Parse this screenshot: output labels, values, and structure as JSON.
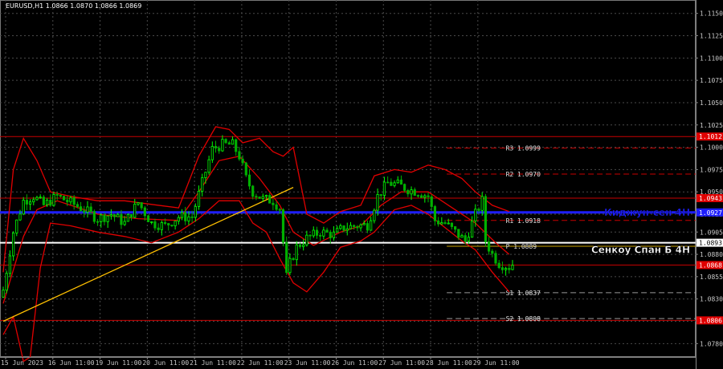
{
  "header": {
    "symbol_info": "EURUSD,H1  1.0866 1.0870 1.0866 1.0869"
  },
  "colors": {
    "background": "#000000",
    "grid": "#4a4a4a",
    "bull_candle": "#00ff00",
    "bear_candle": "#00b000",
    "band": "#e00000",
    "trend": "#ffc000",
    "kijun": "#1e1eff",
    "senkou": "#ffffff",
    "resistance": "#c80000",
    "pivot": "#c8a000",
    "support_dash": "#999999",
    "badge_red": "#e00000",
    "badge_blue": "#1e1eff",
    "badge_white": "#ffffff"
  },
  "chart_data": {
    "type": "candlestick",
    "ylim": [
      1.0765,
      1.1165
    ],
    "yticks": [
      "1.1150",
      "1.1125",
      "1.1100",
      "1.1075",
      "1.1050",
      "1.1025",
      "1.1000",
      "1.0975",
      "1.0950",
      "1.0925",
      "1.0905",
      "1.0880",
      "1.0855",
      "1.0830",
      "1.0805",
      "1.0780"
    ],
    "ytick_values": [
      1.115,
      1.1125,
      1.11,
      1.1075,
      1.105,
      1.1025,
      1.1,
      1.0975,
      1.095,
      1.0925,
      1.0905,
      1.088,
      1.0855,
      1.083,
      1.0805,
      1.078
    ],
    "x_labels": [
      "15 Jun 2023",
      "16 Jun 11:00",
      "19 Jun 11:00",
      "20 Jun 11:00",
      "21 Jun 11:00",
      "22 Jun 11:00",
      "23 Jun 11:00",
      "26 Jun 11:00",
      "27 Jun 11:00",
      "28 Jun 11:00",
      "29 Jun 11:00"
    ],
    "x_label_bars": [
      0,
      14,
      28,
      42,
      56,
      70,
      84,
      98,
      112,
      126,
      140
    ],
    "bar_count": 152,
    "close_path": [
      [
        0,
        1.084
      ],
      [
        3,
        1.0905
      ],
      [
        6,
        1.094
      ],
      [
        9,
        1.0945
      ],
      [
        12,
        1.0935
      ],
      [
        16,
        1.0945
      ],
      [
        20,
        1.0938
      ],
      [
        24,
        1.093
      ],
      [
        28,
        1.092
      ],
      [
        32,
        1.0925
      ],
      [
        36,
        1.0915
      ],
      [
        40,
        1.0938
      ],
      [
        44,
        1.0915
      ],
      [
        48,
        1.0912
      ],
      [
        52,
        1.0922
      ],
      [
        56,
        1.0922
      ],
      [
        59,
        1.096
      ],
      [
        62,
        1.0998
      ],
      [
        65,
        1.1003
      ],
      [
        68,
        1.1003
      ],
      [
        70,
        1.099
      ],
      [
        72,
        1.0965
      ],
      [
        74,
        1.095
      ],
      [
        77,
        1.0942
      ],
      [
        80,
        1.094
      ],
      [
        82,
        1.0932
      ],
      [
        84,
        1.0855
      ],
      [
        85,
        1.087
      ],
      [
        87,
        1.0888
      ],
      [
        90,
        1.0898
      ],
      [
        94,
        1.0905
      ],
      [
        98,
        1.0902
      ],
      [
        101,
        1.091
      ],
      [
        105,
        1.0912
      ],
      [
        108,
        1.0913
      ],
      [
        111,
        1.0945
      ],
      [
        114,
        1.096
      ],
      [
        117,
        1.0958
      ],
      [
        120,
        1.0953
      ],
      [
        123,
        1.095
      ],
      [
        126,
        1.0945
      ],
      [
        128,
        1.0918
      ],
      [
        131,
        1.0915
      ],
      [
        134,
        1.0905
      ],
      [
        137,
        1.0895
      ],
      [
        140,
        1.0925
      ],
      [
        142,
        1.094
      ],
      [
        143,
        1.0895
      ],
      [
        145,
        1.088
      ],
      [
        147,
        1.087
      ],
      [
        150,
        1.0866
      ],
      [
        151,
        1.0869
      ]
    ],
    "band_upper": [
      [
        0,
        1.086
      ],
      [
        3,
        1.0975
      ],
      [
        6,
        1.101
      ],
      [
        10,
        1.0985
      ],
      [
        14,
        1.095
      ],
      [
        20,
        1.0945
      ],
      [
        28,
        1.094
      ],
      [
        36,
        1.094
      ],
      [
        44,
        1.0936
      ],
      [
        52,
        1.0932
      ],
      [
        58,
        1.099
      ],
      [
        63,
        1.1023
      ],
      [
        67,
        1.102
      ],
      [
        71,
        1.1005
      ],
      [
        76,
        1.101
      ],
      [
        80,
        1.0995
      ],
      [
        83,
        1.099
      ],
      [
        86,
        1.1
      ],
      [
        90,
        1.0925
      ],
      [
        95,
        1.0915
      ],
      [
        100,
        1.0928
      ],
      [
        106,
        1.0935
      ],
      [
        110,
        1.0968
      ],
      [
        116,
        1.0975
      ],
      [
        121,
        1.0972
      ],
      [
        126,
        1.098
      ],
      [
        131,
        1.0975
      ],
      [
        136,
        1.0965
      ],
      [
        140,
        1.095
      ],
      [
        145,
        1.0935
      ],
      [
        150,
        1.0928
      ]
    ],
    "band_lower": [
      [
        0,
        1.079
      ],
      [
        3,
        1.081
      ],
      [
        6,
        1.076
      ],
      [
        8,
        1.0765
      ],
      [
        11,
        1.0865
      ],
      [
        14,
        1.0915
      ],
      [
        20,
        1.0912
      ],
      [
        28,
        1.0905
      ],
      [
        36,
        1.09
      ],
      [
        44,
        1.0893
      ],
      [
        52,
        1.0905
      ],
      [
        58,
        1.092
      ],
      [
        64,
        1.094
      ],
      [
        70,
        1.094
      ],
      [
        74,
        1.0915
      ],
      [
        78,
        1.0905
      ],
      [
        82,
        1.0875
      ],
      [
        86,
        1.0848
      ],
      [
        90,
        1.0838
      ],
      [
        95,
        1.086
      ],
      [
        100,
        1.0888
      ],
      [
        106,
        1.0895
      ],
      [
        110,
        1.0905
      ],
      [
        116,
        1.093
      ],
      [
        121,
        1.0935
      ],
      [
        126,
        1.0925
      ],
      [
        131,
        1.091
      ],
      [
        136,
        1.0895
      ],
      [
        140,
        1.0885
      ],
      [
        145,
        1.086
      ],
      [
        150,
        1.0838
      ]
    ],
    "band_mid": [
      [
        0,
        1.0825
      ],
      [
        6,
        1.09
      ],
      [
        10,
        1.093
      ],
      [
        16,
        1.094
      ],
      [
        28,
        1.0925
      ],
      [
        40,
        1.092
      ],
      [
        52,
        1.0918
      ],
      [
        58,
        1.095
      ],
      [
        64,
        1.0985
      ],
      [
        70,
        1.099
      ],
      [
        76,
        1.0965
      ],
      [
        82,
        1.0935
      ],
      [
        86,
        1.0905
      ],
      [
        92,
        1.089
      ],
      [
        100,
        1.0905
      ],
      [
        106,
        1.0912
      ],
      [
        112,
        1.0935
      ],
      [
        118,
        1.095
      ],
      [
        126,
        1.095
      ],
      [
        132,
        1.0935
      ],
      [
        140,
        1.0915
      ],
      [
        146,
        1.0893
      ],
      [
        150,
        1.088
      ]
    ],
    "trend_line": [
      [
        0,
        1.0805
      ],
      [
        86,
        1.0955
      ]
    ],
    "hlines": [
      {
        "name": "resistance-1-1012",
        "value": 1.1012,
        "label": "1.1012",
        "style": "solid-red"
      },
      {
        "name": "resistance-2-0943",
        "value": 1.0943,
        "label": "1.0943",
        "style": "solid-red"
      },
      {
        "name": "kijun-sen",
        "value": 1.0927,
        "label": "1.0927",
        "style": "blue"
      },
      {
        "name": "senkou-span-b",
        "value": 1.0893,
        "label": "1.0893",
        "style": "white"
      },
      {
        "name": "support-0868",
        "value": 1.0868,
        "label": "1.0868",
        "style": "solid-red"
      },
      {
        "name": "support-0806",
        "value": 1.0806,
        "label": "1.0806",
        "style": "solid-red"
      }
    ],
    "pivots": [
      {
        "name": "r3",
        "value": 1.0999,
        "label": "R3 1.0999",
        "style": "dash-red"
      },
      {
        "name": "r2",
        "value": 1.097,
        "label": "R2 1.0970",
        "style": "dash-red"
      },
      {
        "name": "r1",
        "value": 1.0918,
        "label": "R1 1.0918",
        "style": "dash-red"
      },
      {
        "name": "p",
        "value": 1.0889,
        "label": "P 1.0889",
        "style": "pivot"
      },
      {
        "name": "s1",
        "value": 1.0837,
        "label": "S1 1.0837",
        "style": "dash-gray"
      },
      {
        "name": "s2",
        "value": 1.0808,
        "label": "S2 1.0808",
        "style": "dash-gray"
      }
    ],
    "annotations": [
      {
        "name": "kijun-annotation",
        "text": "Киджун-сен 4Н",
        "value": 1.0927,
        "color": "#1e1eff"
      },
      {
        "name": "senkou-annotation",
        "text": "Сенкоу Спан Б 4Н",
        "value": 1.0885,
        "color": "#ffffff"
      }
    ]
  }
}
